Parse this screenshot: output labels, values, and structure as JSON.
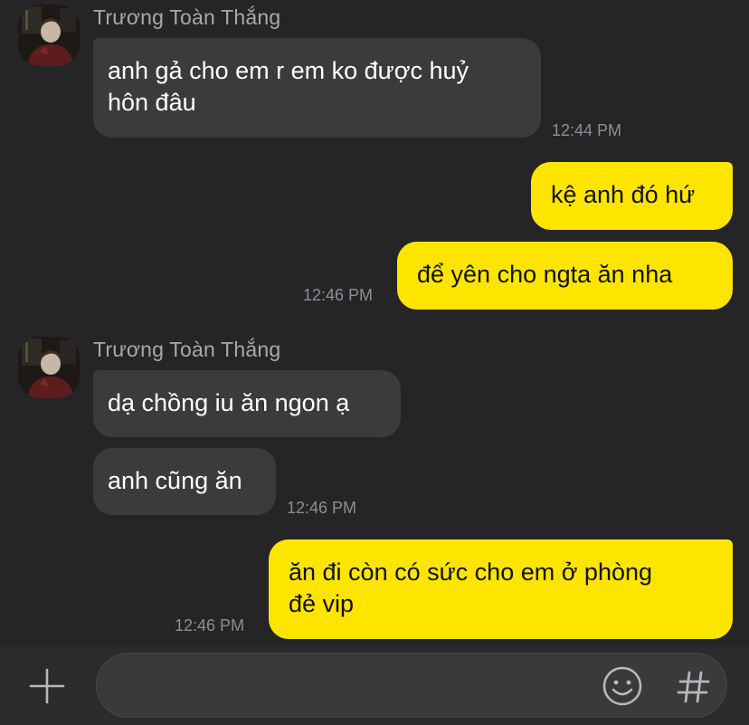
{
  "colors": {
    "background": "#252528",
    "incoming_bubble": "#3b3b3e",
    "outgoing_bubble": "#fee500",
    "timestamp": "#8d8d92",
    "sender_name": "#a9a9ad"
  },
  "thread": {
    "group1": {
      "sender": "Trương Toàn Thắng",
      "messages": [
        "anh gả cho em r em ko được huỷ\nhôn đâu"
      ],
      "time": "12:44 PM"
    },
    "group2": {
      "messages": [
        "kệ anh đó hứ",
        "để yên cho ngta ăn nha"
      ],
      "time": "12:46 PM"
    },
    "group3": {
      "sender": "Trương Toàn Thắng",
      "messages": [
        "dạ chồng iu ăn ngon ạ",
        "anh cũng ăn"
      ],
      "time": "12:46 PM"
    },
    "group4": {
      "messages": [
        "ăn đi còn có sức cho em ở phòng\nđẻ vip"
      ],
      "time": "12:46 PM"
    }
  },
  "composer": {
    "input_value": "",
    "icons": [
      "plus-icon",
      "emoji-icon",
      "hash-icon"
    ]
  }
}
